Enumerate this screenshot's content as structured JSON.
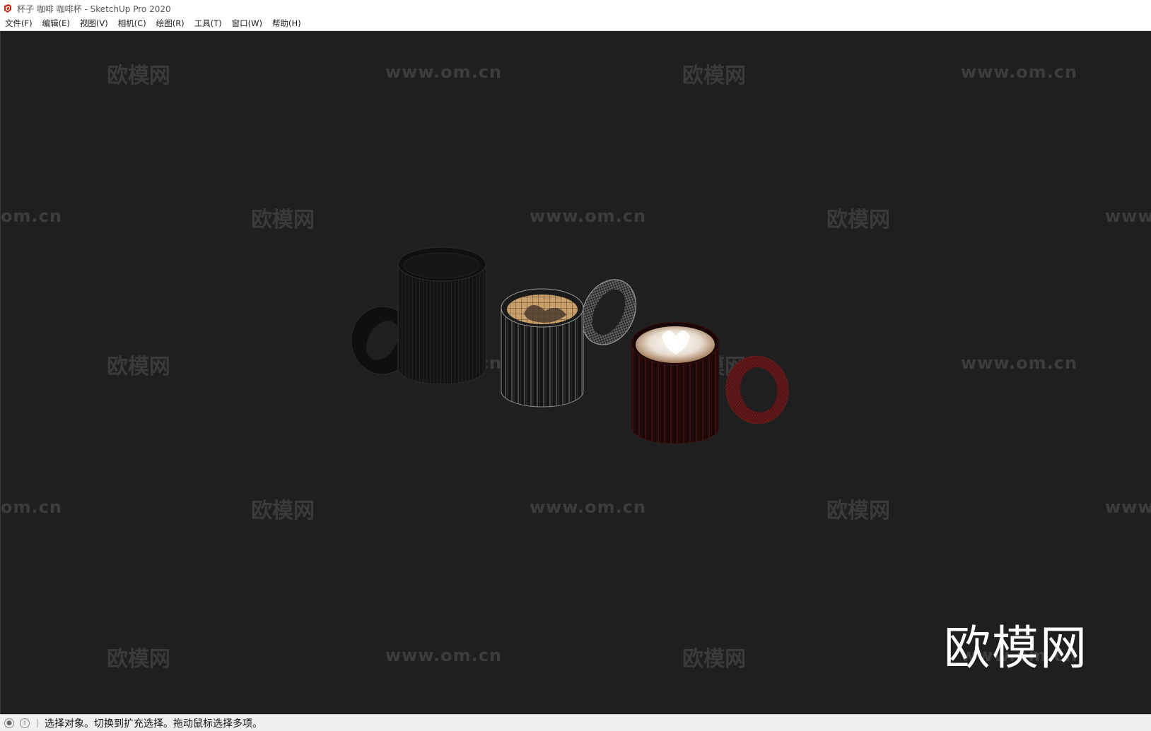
{
  "window": {
    "title": "杯子 咖啡 咖啡杯 - SketchUp Pro 2020"
  },
  "menu": {
    "items": [
      {
        "label": "文件(F)"
      },
      {
        "label": "编辑(E)"
      },
      {
        "label": "视图(V)"
      },
      {
        "label": "相机(C)"
      },
      {
        "label": "绘图(R)"
      },
      {
        "label": "工具(T)"
      },
      {
        "label": "窗口(W)"
      },
      {
        "label": "帮助(H)"
      }
    ]
  },
  "viewport": {
    "background_color": "#1f1f1f",
    "watermark_cn": "欧模网",
    "watermark_en": "www.om.cn",
    "watermark_en_partial_left": "om.cn",
    "watermark_en_partial_right": "www.",
    "brand_watermark": "欧模网"
  },
  "scene": {
    "objects": [
      {
        "name": "black-mug",
        "color": "#151515"
      },
      {
        "name": "latte-mug-with-coffee",
        "color": "#1a1a1a",
        "liquid_color": "#c9a06a"
      },
      {
        "name": "red-mug-with-latte-art",
        "color": "#2a0d0d",
        "liquid_color": "#efe6dc"
      }
    ]
  },
  "statusbar": {
    "icon_geo": "geo-location-icon",
    "icon_info": "info-icon",
    "message": "选择对象。切换到扩充选择。拖动鼠标选择多项。"
  },
  "colors": {
    "app_icon_red": "#c8281e",
    "status_bg": "#f0f0f0"
  }
}
